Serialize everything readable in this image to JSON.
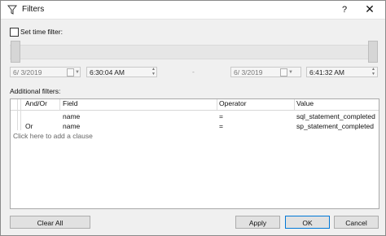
{
  "window": {
    "title": "Filters",
    "help_label": "?",
    "close_label": "✕"
  },
  "time_filter": {
    "checkbox_label": "Set time filter:",
    "checked": false,
    "start_date": "6/  3/2019",
    "start_time": "6:30:04 AM",
    "separator": "-",
    "end_date": "6/  3/2019",
    "end_time": "6:41:32 AM"
  },
  "filters": {
    "label": "Additional filters:",
    "columns": {
      "andor": "And/Or",
      "field": "Field",
      "operator": "Operator",
      "value": "Value"
    },
    "rows": [
      {
        "andor": "",
        "field": "name",
        "operator": "=",
        "value": "sql_statement_completed"
      },
      {
        "andor": "Or",
        "field": "name",
        "operator": "=",
        "value": "sp_statement_completed"
      }
    ],
    "add_clause": "Click here to add a clause"
  },
  "buttons": {
    "clear_all": "Clear All",
    "apply": "Apply",
    "ok": "OK",
    "cancel": "Cancel"
  }
}
